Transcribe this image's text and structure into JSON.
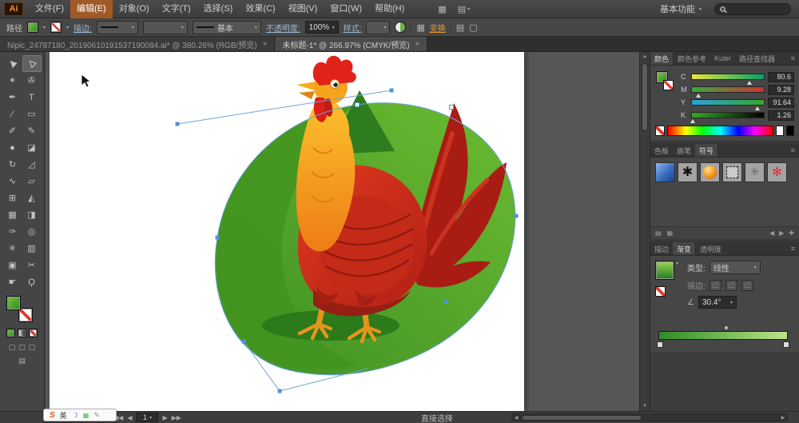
{
  "menubar": {
    "logo": "Ai",
    "items": [
      "文件(F)",
      "编辑(E)",
      "对象(O)",
      "文字(T)",
      "选择(S)",
      "效果(C)",
      "视图(V)",
      "窗口(W)",
      "帮助(H)"
    ],
    "workspace": "基本功能",
    "search_value": ""
  },
  "controlbar": {
    "context": "路径",
    "stroke_link": "描边:",
    "brush_name": "基本",
    "opacity_link": "不透明度:",
    "opacity_value": "100%",
    "style_link": "样式:",
    "transform_link": "变换"
  },
  "tabs": [
    {
      "title": "Nipic_24787180_20190610191537190084.ai* @ 380.26% (RGB/预览)",
      "close": "×"
    },
    {
      "title": "未标题-1* @ 266.97% (CMYK/预览)",
      "close": "×"
    }
  ],
  "tools": [
    {
      "name": "selection",
      "glyph": "▶"
    },
    {
      "name": "direct-selection",
      "glyph": "▷"
    },
    {
      "name": "magic-wand",
      "glyph": "✶"
    },
    {
      "name": "lasso",
      "glyph": "✇"
    },
    {
      "name": "pen",
      "glyph": "✒"
    },
    {
      "name": "type",
      "glyph": "T"
    },
    {
      "name": "line-segment",
      "glyph": "∕"
    },
    {
      "name": "rectangle",
      "glyph": "▭"
    },
    {
      "name": "paintbrush",
      "glyph": "✐"
    },
    {
      "name": "pencil",
      "glyph": "✎"
    },
    {
      "name": "blob-brush",
      "glyph": "●"
    },
    {
      "name": "eraser",
      "glyph": "◪"
    },
    {
      "name": "rotate",
      "glyph": "↻"
    },
    {
      "name": "scale",
      "glyph": "◿"
    },
    {
      "name": "width",
      "glyph": "∿"
    },
    {
      "name": "free-transform",
      "glyph": "▱"
    },
    {
      "name": "shape-builder",
      "glyph": "⊞"
    },
    {
      "name": "perspective-grid",
      "glyph": "◭"
    },
    {
      "name": "mesh",
      "glyph": "▦"
    },
    {
      "name": "gradient",
      "glyph": "◨"
    },
    {
      "name": "eyedropper",
      "glyph": "✑"
    },
    {
      "name": "blend",
      "glyph": "◎"
    },
    {
      "name": "symbol-sprayer",
      "glyph": "✳"
    },
    {
      "name": "column-graph",
      "glyph": "▥"
    },
    {
      "name": "artboard",
      "glyph": "▣"
    },
    {
      "name": "slice",
      "glyph": "✂"
    },
    {
      "name": "hand",
      "glyph": "☛"
    },
    {
      "name": "zoom",
      "glyph": "Ϙ"
    }
  ],
  "color_panel": {
    "tabs": [
      "颜色",
      "颜色参考",
      "Kuler",
      "路径查找器"
    ],
    "sliders": [
      {
        "label": "C",
        "value": "80.6"
      },
      {
        "label": "M",
        "value": "9.28"
      },
      {
        "label": "Y",
        "value": "91.64"
      },
      {
        "label": "K",
        "value": "1.26"
      }
    ]
  },
  "symbols_panel": {
    "tabs": [
      "色板",
      "画笔",
      "符号"
    ],
    "thumbs": [
      {
        "name": "banner-symbol"
      },
      {
        "name": "ink-splat-symbol",
        "glyph": "✱"
      },
      {
        "name": "orange-ball-symbol"
      },
      {
        "name": "dashed-frame-symbol"
      },
      {
        "name": "gear-symbol",
        "glyph": "✳"
      },
      {
        "name": "red-flower-symbol",
        "glyph": "✻"
      }
    ]
  },
  "gradient_panel": {
    "tabs": [
      "描边",
      "渐变",
      "透明度"
    ],
    "type_label": "类型:",
    "type_value": "线性",
    "stroke_label": "描边:",
    "angle_value": "30.4°"
  },
  "statusbar": {
    "artboard_value": "1",
    "tool_name": "直接选择"
  },
  "ime": {
    "logo": "S",
    "lang": "英"
  },
  "glyphs": {
    "caret": "▼",
    "caret_sm": "▾",
    "left": "◀",
    "right": "▶",
    "dbl_left": "◀◀",
    "dbl_right": "▶▶",
    "up": "▲",
    "down": "▼",
    "menu": "≡",
    "angle": "∠",
    "grid": "▦",
    "layout": "▤",
    "square": "▢",
    "moon": "☽",
    "keyboard": "▦",
    "pen_sm": "✎",
    "plus": "✚"
  },
  "colors": {
    "fill_green": "#3f9e2f",
    "selection_blue": "#5b9bd5",
    "menu_highlight_orange": "#a05a28"
  }
}
